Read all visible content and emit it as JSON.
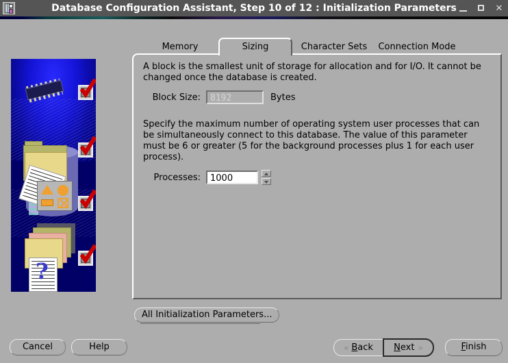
{
  "window": {
    "title": "Database Configuration Assistant, Step 10 of 12 : Initialization Parameters",
    "app_icon": "database-chip-icon",
    "minimize_label": "minimize-icon",
    "maximize_label": "maximize-icon",
    "close_label": "✕",
    "titlebar_bg": "#555555",
    "face_color": "#adadad"
  },
  "illustration": {
    "name": "wizard-illustration",
    "background": "#000066",
    "items": [
      {
        "icon": "cpu-chip-icon",
        "checked": true
      },
      {
        "icon": "folder-documents-icon",
        "checked": true
      },
      {
        "icon": "shapes-panel-icon",
        "checked": true
      },
      {
        "icon": "question-document-icon",
        "checked": true
      }
    ],
    "check_color": "#cc0000"
  },
  "tabs": [
    {
      "label": "Memory",
      "selected": false
    },
    {
      "label": "Sizing",
      "selected": true
    },
    {
      "label": "Character Sets",
      "selected": false
    },
    {
      "label": "Connection Mode",
      "selected": false
    }
  ],
  "sizing": {
    "block_description": "A block is the smallest unit of storage for allocation and for I/O. It cannot be changed once the database is created.",
    "block_size_label": "Block Size:",
    "block_size_value": "8192",
    "block_size_unit": "Bytes",
    "block_size_enabled": false,
    "processes_description": "Specify the maximum number of operating system user processes that can be simultaneously connect to this database. The value of this parameter must be 6 or greater (5 for the background processes plus 1 for each user process).",
    "processes_label": "Processes:",
    "processes_value": "1000",
    "spinner_up_icon": "spinner-up-arrow-icon",
    "spinner_down_icon": "spinner-down-arrow-icon"
  },
  "actions": {
    "all_parameters": "All Initialization Parameters...",
    "cancel": "Cancel",
    "help": "Help",
    "back_mnemonic": "B",
    "back_rest": "ack",
    "next_mnemonic": "N",
    "next_rest": "ext",
    "finish_mnemonic": "F",
    "finish_rest": "inish",
    "back_chevron": "«",
    "next_chevron": "»"
  }
}
